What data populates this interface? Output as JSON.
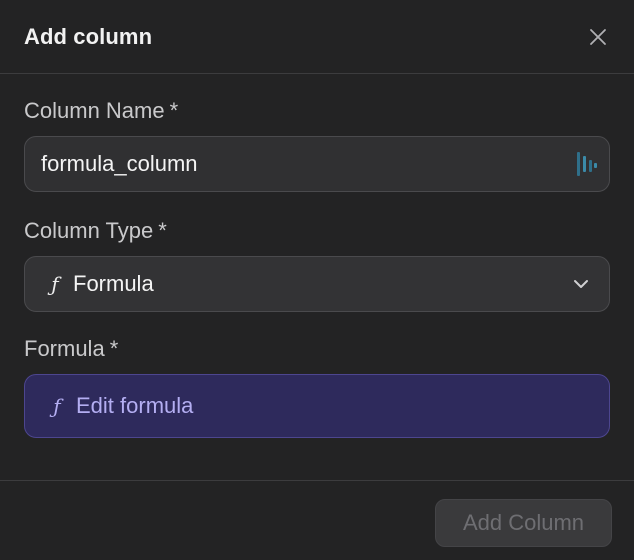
{
  "dialog": {
    "title": "Add column"
  },
  "fields": {
    "name": {
      "label": "Column Name",
      "required_mark": "*",
      "value": "formula_column"
    },
    "type": {
      "label": "Column Type",
      "required_mark": "*",
      "icon": "function-icon",
      "icon_glyph": "ƒ",
      "selected": "Formula"
    },
    "formula": {
      "label": "Formula",
      "required_mark": "*",
      "icon_glyph": "ƒ",
      "button_label": "Edit formula"
    }
  },
  "footer": {
    "submit_label": "Add Column",
    "submit_disabled": true
  },
  "colors": {
    "background": "#232324",
    "input_bg": "#303032",
    "formula_bg": "#2e2a5c",
    "formula_text": "#b4aef2",
    "disabled_text": "#6e6e72"
  }
}
